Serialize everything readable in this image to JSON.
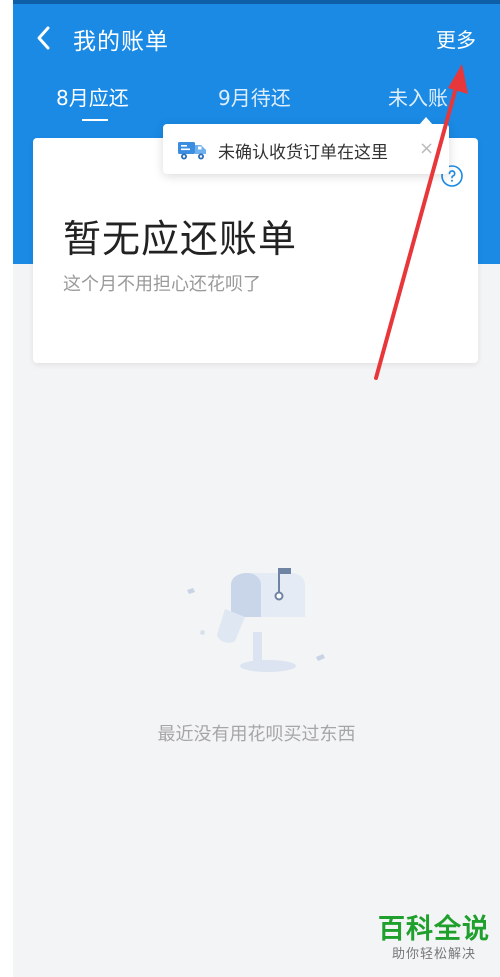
{
  "header": {
    "title": "我的账单",
    "more_label": "更多",
    "back_icon": "chevron-left-icon"
  },
  "tabs": [
    {
      "label": "8月应还",
      "active": true
    },
    {
      "label": "9月待还",
      "active": false
    },
    {
      "label": "未入账",
      "active": false
    }
  ],
  "tooltip": {
    "icon": "delivery-truck-icon",
    "text": "未确认收货订单在这里",
    "close_label": "×"
  },
  "card": {
    "title": "暂无应还账单",
    "subtitle": "这个月不用担心还花呗了",
    "help_icon": "help-icon"
  },
  "empty_state": {
    "illustration": "mailbox-icon",
    "text": "最近没有用花呗买过东西"
  },
  "watermark": {
    "main": "百科全说",
    "sub": "助你轻松解决"
  },
  "colors": {
    "brand_blue": "#1a8ae5",
    "annotation_red": "#e8373a",
    "watermark_green": "#1fa02c"
  }
}
